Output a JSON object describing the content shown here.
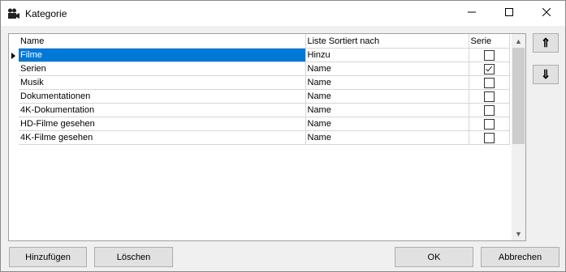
{
  "window": {
    "title": "Kategorie"
  },
  "grid": {
    "columns": [
      "Name",
      "Liste Sortiert nach",
      "Serie"
    ],
    "rows": [
      {
        "name": "Filme",
        "sort": "Hinzu",
        "serie": false,
        "selected": true
      },
      {
        "name": "Serien",
        "sort": "Name",
        "serie": true,
        "selected": false
      },
      {
        "name": "Musik",
        "sort": "Name",
        "serie": false,
        "selected": false
      },
      {
        "name": "Dokumentationen",
        "sort": "Name",
        "serie": false,
        "selected": false
      },
      {
        "name": "4K-Dokumentation",
        "sort": "Name",
        "serie": false,
        "selected": false
      },
      {
        "name": "HD-Filme gesehen",
        "sort": "Name",
        "serie": false,
        "selected": false
      },
      {
        "name": "4K-Filme gesehen",
        "sort": "Name",
        "serie": false,
        "selected": false
      }
    ]
  },
  "side_buttons": {
    "up": "⇑",
    "down": "⇓"
  },
  "buttons": {
    "add": "Hinzufügen",
    "delete": "Löschen",
    "ok": "OK",
    "cancel": "Abbrechen"
  },
  "icons": {
    "app": "video-camera-icon",
    "minimize": "minimize-icon",
    "maximize": "maximize-icon",
    "close": "close-icon"
  },
  "colors": {
    "selection": "#0078d7"
  }
}
